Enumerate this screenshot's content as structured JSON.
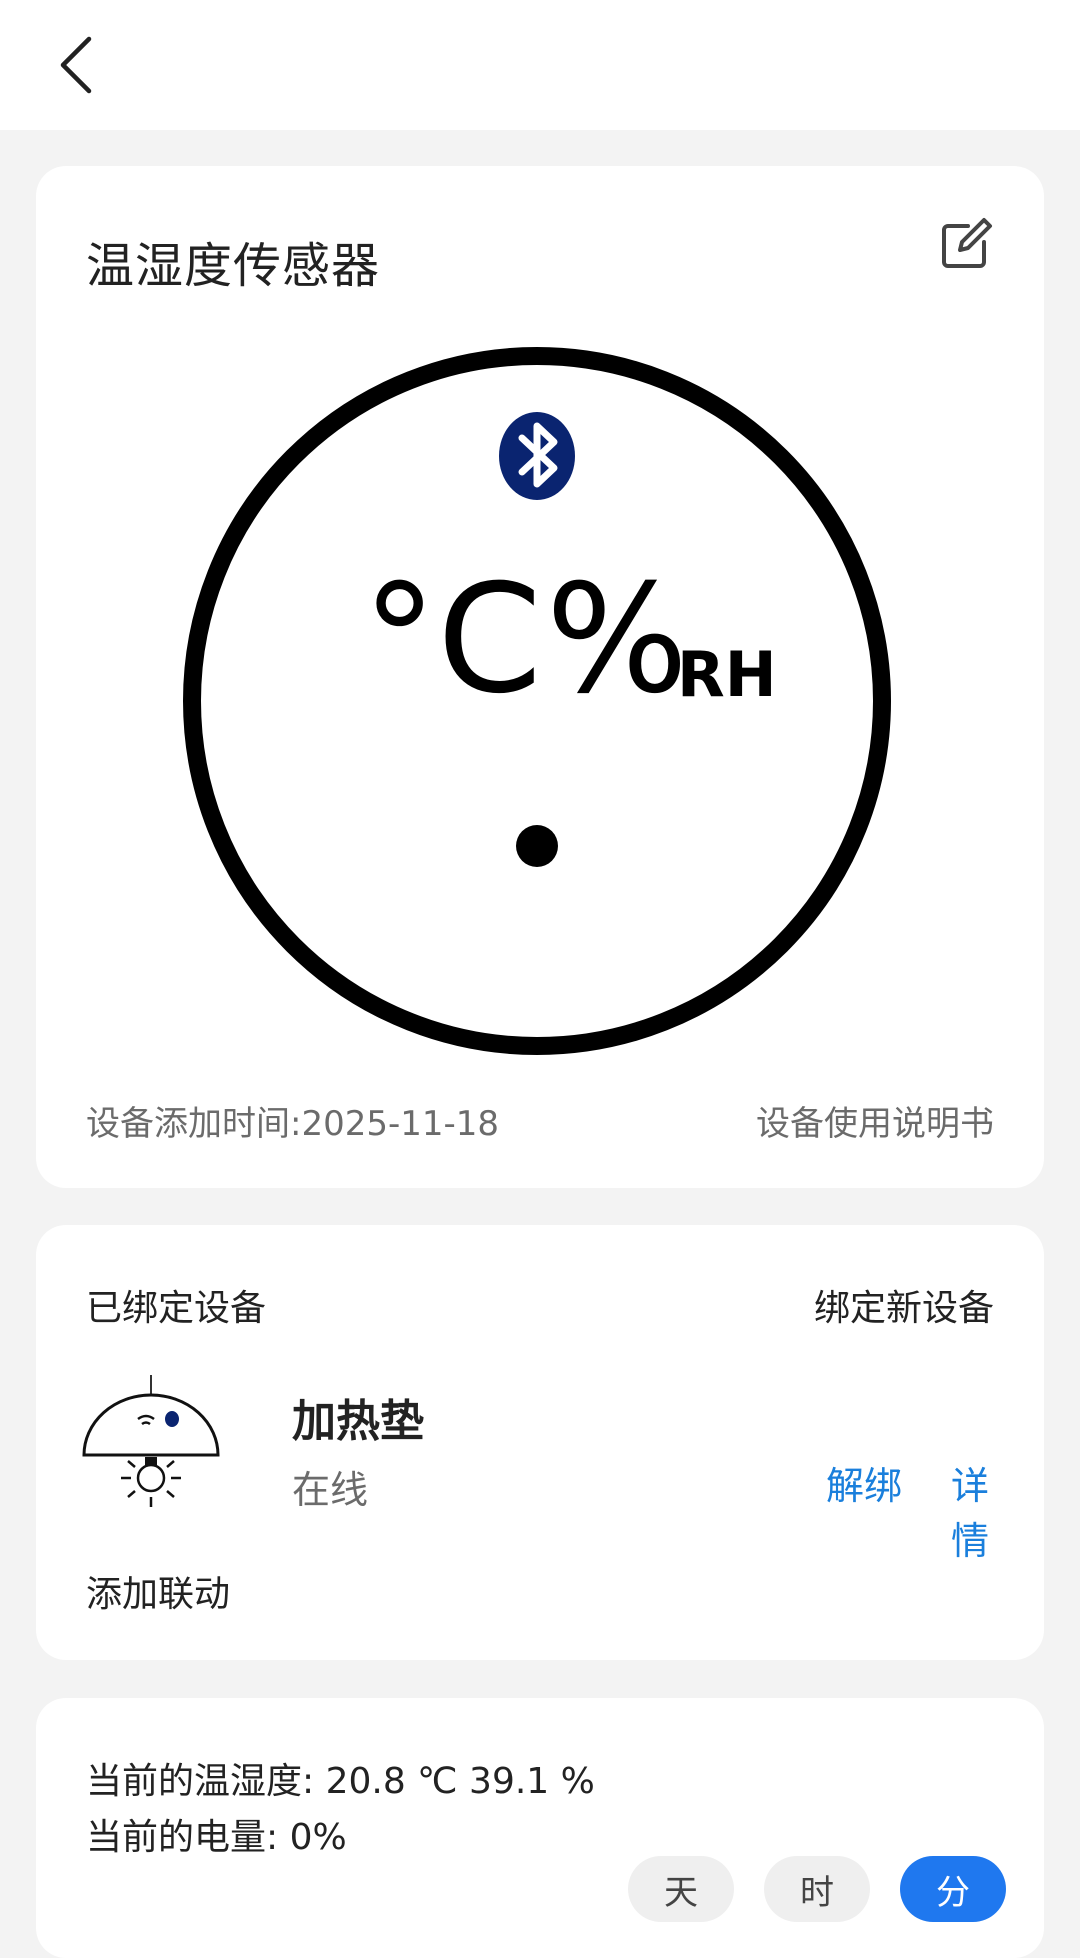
{
  "header": {
    "back_icon": "chevron-left-icon"
  },
  "sensor_card": {
    "title": "温湿度传感器",
    "edit_icon": "edit-icon",
    "illustration": {
      "celsius_symbol": "°C",
      "humidity_symbol": "%",
      "humidity_unit": "RH",
      "bluetooth_icon": "bluetooth-icon",
      "bluetooth_color": "#0a2470"
    },
    "added_label": "设备添加时间:",
    "added_date": "2025-11-18",
    "manual_label": "设备使用说明书"
  },
  "bound_card": {
    "label": "已绑定设备",
    "bind_new_label": "绑定新设备",
    "device": {
      "name": "加热垫",
      "status": "在线",
      "icon": "heater-lamp-icon",
      "unbind_label": "解绑",
      "detail_label": "详情"
    },
    "add_linkage_label": "添加联动",
    "link_color": "#1a7fdc"
  },
  "reading_card": {
    "temp_humidity_text": "当前的温湿度: 20.8 ℃ 39.1 %",
    "battery_text": "当前的电量: 0%",
    "tabs": [
      {
        "label": "天",
        "active": false
      },
      {
        "label": "时",
        "active": false
      },
      {
        "label": "分",
        "active": true
      }
    ],
    "active_color": "#1f78ef"
  }
}
